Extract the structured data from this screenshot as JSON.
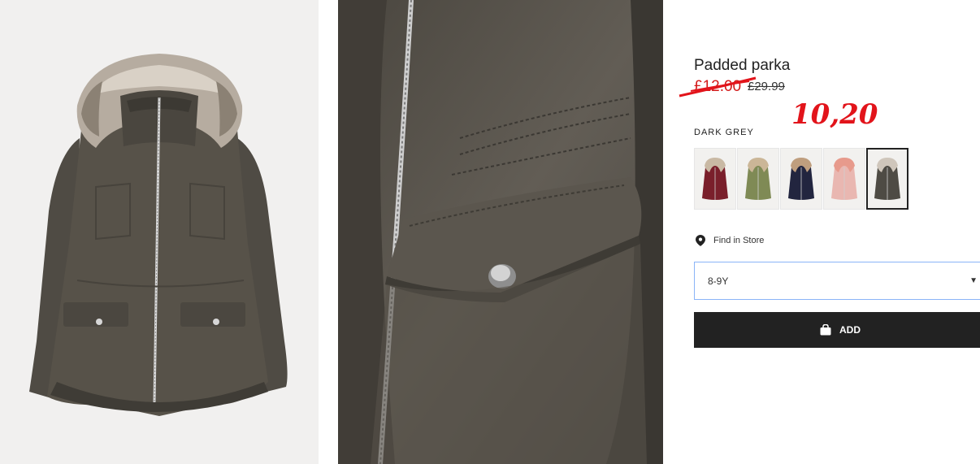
{
  "product": {
    "title": "Padded parka",
    "sale_price": "£12.00",
    "original_price": "£29.99",
    "annotation": "10,20",
    "color_name": "DARK GREY"
  },
  "swatches": [
    {
      "name": "burgundy",
      "body_color": "#7a1f2b",
      "fur_color": "#c9b9a4"
    },
    {
      "name": "khaki",
      "body_color": "#7f8a55",
      "fur_color": "#cbb697"
    },
    {
      "name": "navy",
      "body_color": "#22253f",
      "fur_color": "#bf9e7e"
    },
    {
      "name": "light-pink",
      "body_color": "#e9b7b1",
      "fur_color": "#e79a8c"
    },
    {
      "name": "dark-grey",
      "body_color": "#4e4b44",
      "fur_color": "#cfc6bb",
      "selected": true
    }
  ],
  "store": {
    "label": "Find in Store",
    "icon": "map-pin-icon"
  },
  "size_select": {
    "value": "8-9Y",
    "icon": "chevron-down-icon"
  },
  "add_button": {
    "label": "ADD",
    "icon": "shopping-bag-icon"
  },
  "colors": {
    "accent_red": "#e2141b",
    "button_bg": "#222222",
    "focus_border": "#8ab4f8",
    "parka_body": "#534f48"
  }
}
